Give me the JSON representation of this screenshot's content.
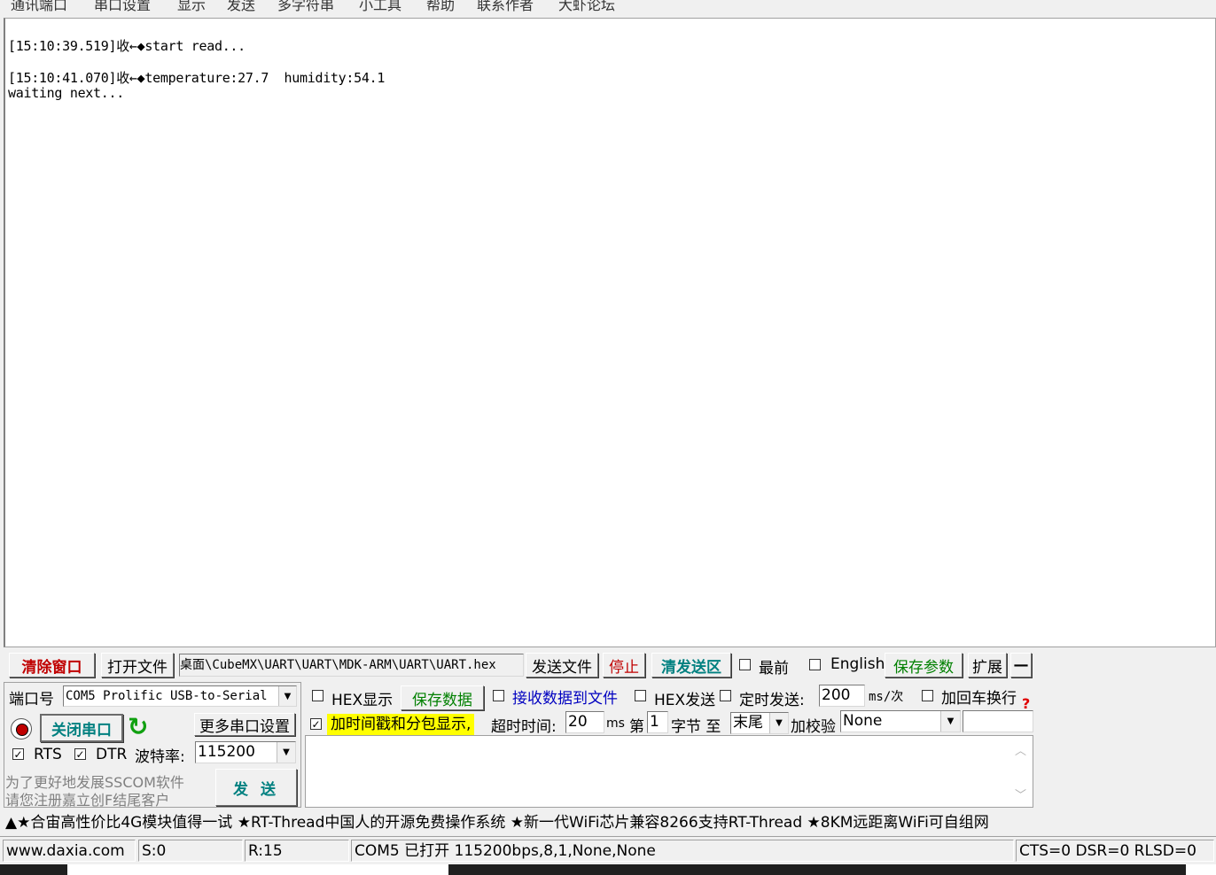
{
  "menu": [
    "通讯端口",
    "串口设置",
    "显示",
    "发送",
    "多字符串",
    "小工具",
    "帮助",
    "联系作者",
    "大虾论坛"
  ],
  "receive": {
    "lines": [
      "[15:10:39.519]收←◆start read...",
      "[15:10:41.070]收←◆temperature:27.7  humidity:54.1",
      "waiting next..."
    ]
  },
  "toolbar": {
    "clear_window": "清除窗口",
    "open_file": "打开文件",
    "file_path": "桌面\\CubeMX\\UART\\UART\\MDK-ARM\\UART\\UART.hex",
    "send_file": "发送文件",
    "stop": "停止",
    "clear_send": "清发送区",
    "topmost": "最前",
    "english": "English",
    "save_params": "保存参数",
    "expand": "扩展",
    "collapse": "—"
  },
  "port": {
    "port_label": "端口号",
    "port_value": "COM5 Prolific USB-to-Serial",
    "close_port": "关闭串口",
    "more_settings": "更多串口设置",
    "rts_label": "RTS",
    "dtr_label": "DTR",
    "baud_label": "波特率:",
    "baud_value": "115200",
    "promo_line1": "为了更好地发展SSCOM软件",
    "promo_line2": "请您注册嘉立创F结尾客户",
    "send": "发  送"
  },
  "options": {
    "hex_display": "HEX显示",
    "save_data": "保存数据",
    "recv_to_file": "接收数据到文件",
    "hex_send": "HEX发送",
    "timed_send": "定时发送:",
    "timed_value": "200",
    "timed_unit": "ms/次",
    "add_crlf": "加回车换行",
    "timestamp": "加时间戳和分包显示,",
    "timeout_label": "超时时间:",
    "timeout_value": "20",
    "timeout_unit": "ms",
    "byte_prefix": "第",
    "byte_value": "1",
    "byte_suffix": "字节 至",
    "end_value": "末尾",
    "checksum_label": "加校验",
    "checksum_value": "None",
    "help_mark": "?"
  },
  "ticker": "▲★合宙高性价比4G模块值得一试 ★RT-Thread中国人的开源免费操作系统 ★新一代WiFi芯片兼容8266支持RT-Thread ★8KM远距离WiFi可自组网",
  "status": {
    "site": "www.daxia.com",
    "sent": "S:0",
    "received": "R:15",
    "port_status": "COM5 已打开  115200bps,8,1,None,None",
    "lines": "CTS=0 DSR=0 RLSD=0"
  },
  "colors": {
    "clear_window": "#c00000",
    "save_green": "#008000",
    "clear_send": "#008080",
    "timestamp_bg": "#ffff00",
    "receive_bg": "#ffffff"
  }
}
